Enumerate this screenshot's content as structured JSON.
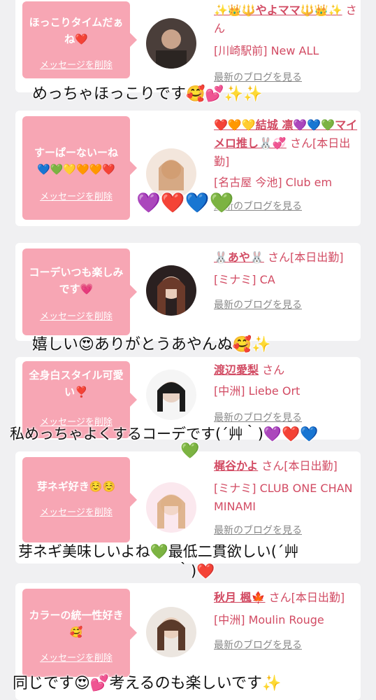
{
  "cards": [
    {
      "message": "ほっこりタイムだぁね❤️",
      "delete_label": "メッセージを削除",
      "name": "✨👑🔱やよママ🔱👑✨",
      "san": "さん",
      "shop": "[川崎駅前] New ALL",
      "blog_label": "最新のブログを見る"
    },
    {
      "message": "すーぱーないーね💙💚💛🧡🧡❤️",
      "delete_label": "メッセージを削除",
      "name": "❤️🧡💛結城 凛💜💙💚マイメロ推し🐰💞",
      "san": "さん[本日出勤]",
      "shop": "[名古屋 今池] Club em",
      "blog_label": "最新のブログを見る"
    },
    {
      "message": "コーデいつも楽しみです💗",
      "delete_label": "メッセージを削除",
      "name": "🐰あや🐰",
      "san": "さん[本日出勤]",
      "shop": "[ミナミ] CA",
      "blog_label": "最新のブログを見る"
    },
    {
      "message": "全身白スタイル可愛い❣️",
      "delete_label": "メッセージを削除",
      "name": "渡辺愛梨",
      "san": "さん",
      "shop": "[中洲] Liebe Ort",
      "blog_label": "最新のブログを見る"
    },
    {
      "message": "芽ネギ好き☺️☺️",
      "delete_label": "メッセージを削除",
      "name": "梶谷かよ",
      "san": "さん[本日出勤]",
      "shop": "[ミナミ] CLUB ONE CHAN MINAMI",
      "blog_label": "最新のブログを見る"
    },
    {
      "message": "カラーの統一性好き🥰",
      "delete_label": "メッセージを削除",
      "name": "秋月 楓🍁",
      "san": "さん[本日出勤]",
      "shop": "[中洲] Moulin Rouge",
      "blog_label": "最新のブログを見る"
    }
  ],
  "overlays": {
    "o1": "めっちゃほっこりです🥰💕✨✨",
    "o2": "💜❤️💙💚",
    "o3": "嬉しい😍ありがとうあやんぬ🥰✨",
    "o4": "私めっちゃよくするコーデです(´艸｀)💜❤️💙",
    "o4b": "💚",
    "o5": "芽ネギ美味しいよね💚最低二貫欲しい(´艸",
    "o5b": "｀)❤️",
    "o6": "同じです😍💕考えるのも楽しいです✨"
  },
  "colors": {
    "bubble": "#f7a6b4",
    "name": "#d24b63",
    "background": "#f0f0f2"
  }
}
